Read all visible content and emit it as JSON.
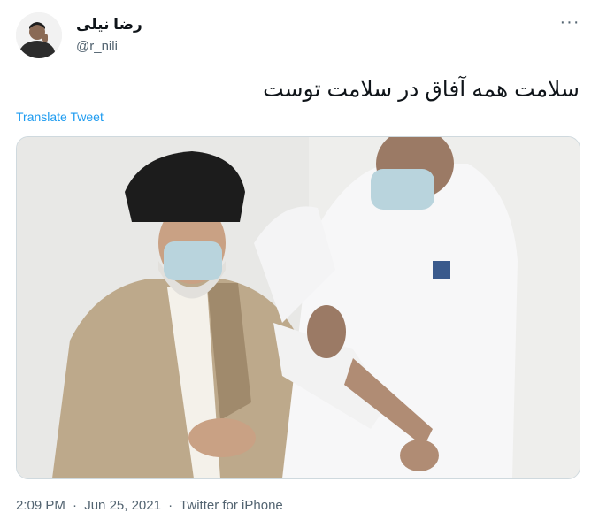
{
  "author": {
    "display_name": "رضا نیلی",
    "handle": "@r_nili",
    "avatar_icon": "user-avatar-photo"
  },
  "menu": {
    "more_label": "···",
    "icon": "more-horizontal-icon"
  },
  "tweet": {
    "text": "سلامت همه آفاق در سلامت توست",
    "translate_label": "Translate Tweet"
  },
  "media": {
    "type": "photo"
  },
  "meta": {
    "time": "2:09 PM",
    "separator": "·",
    "date": "Jun 25, 2021",
    "source": "Twitter for iPhone"
  },
  "colors": {
    "link": "#1d9bf0",
    "secondary_text": "#536471",
    "primary_text": "#0f1419",
    "border": "#cfd9de"
  }
}
